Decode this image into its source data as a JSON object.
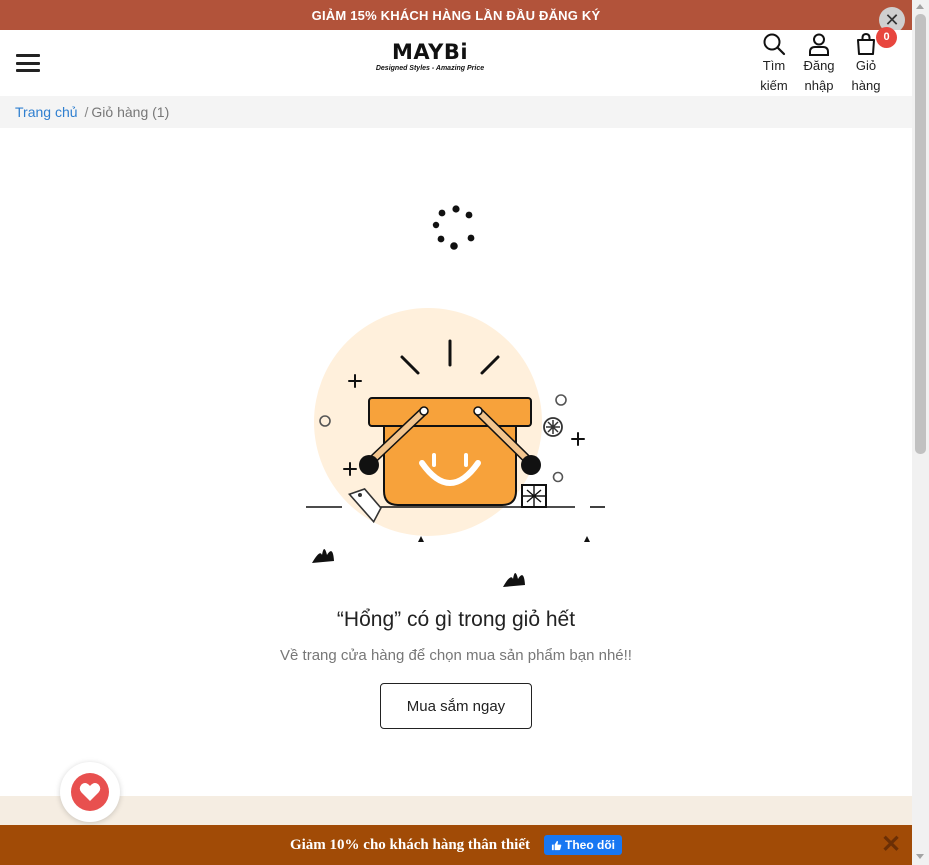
{
  "promo_bar": {
    "text": "GIẢM 15% KHÁCH HÀNG LẦN ĐẦU ĐĂNG KÝ",
    "close_glyph": "✕"
  },
  "header": {
    "brand": "MAYBi",
    "tagline": "Designed Styles - Amazing Price",
    "actions": {
      "search": {
        "line1": "Tìm",
        "line2": "kiếm",
        "icon": "search-icon"
      },
      "login": {
        "line1": "Đăng",
        "line2": "nhập",
        "icon": "user-icon"
      },
      "cart": {
        "line1": "Giỏ",
        "line2": "hàng",
        "icon": "shopping-bag-icon",
        "count": "0"
      }
    }
  },
  "breadcrumb": {
    "home": "Trang chủ",
    "separator": "/",
    "current": "Giỏ hàng (1)"
  },
  "empty_cart": {
    "title": "“Hổng” có gì trong giỏ hết",
    "subtitle": "Về trang cửa hàng để chọn mua sản phẩm bạn nhé!!",
    "button": "Mua sắm ngay"
  },
  "bottom_bar": {
    "text": "Giảm 10% cho khách hàng thân thiết",
    "follow_label": "Theo dõi",
    "close_glyph": "✕"
  },
  "colors": {
    "promo_bg": "#b2533a",
    "bottom_bg": "#a14b06",
    "link": "#2f7fd0",
    "badge": "#e8463e",
    "basket": "#f7a23b",
    "circle": "#fff0dc",
    "facebook": "#1877f2"
  }
}
